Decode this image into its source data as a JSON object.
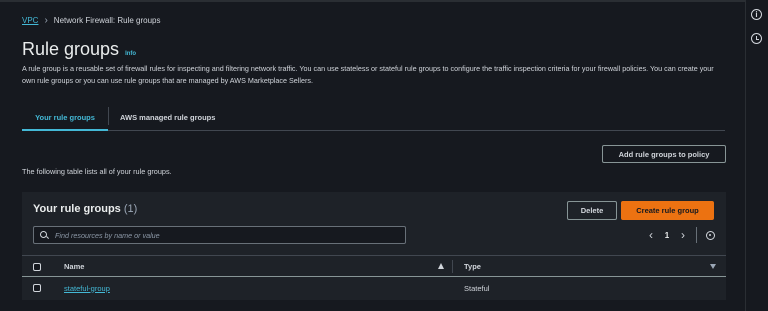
{
  "breadcrumb": {
    "root": "VPC",
    "current": "Network Firewall: Rule groups"
  },
  "page": {
    "title": "Rule groups",
    "info": "Info",
    "description": "A rule group is a reusable set of firewall rules for inspecting and filtering network traffic. You can use stateless or stateful rule groups to configure the traffic inspection criteria for your firewall policies. You can create your own rule groups or you can use rule groups that are managed by AWS Marketplace Sellers."
  },
  "tabs": [
    {
      "label": "Your rule groups",
      "active": true
    },
    {
      "label": "AWS managed rule groups",
      "active": false
    }
  ],
  "actions": {
    "add_to_policy": "Add rule groups to policy"
  },
  "table_caption": "The following table lists all of your rule groups.",
  "panel": {
    "title": "Your rule groups",
    "count": "(1)",
    "delete_label": "Delete",
    "create_label": "Create rule group",
    "search_placeholder": "Find resources by name or value",
    "page_number": "1"
  },
  "table": {
    "columns": [
      "Name",
      "Type"
    ],
    "rows": [
      {
        "name": "stateful-group",
        "type": "Stateful"
      }
    ]
  },
  "icons": {
    "right_rail": [
      "info-icon",
      "history-icon"
    ],
    "pager": [
      "chevron-left-icon",
      "chevron-right-icon",
      "gear-icon"
    ]
  },
  "colors": {
    "background": "#16191f",
    "panel": "#1e2228",
    "link": "#44b9d6",
    "primary": "#ec7211"
  }
}
